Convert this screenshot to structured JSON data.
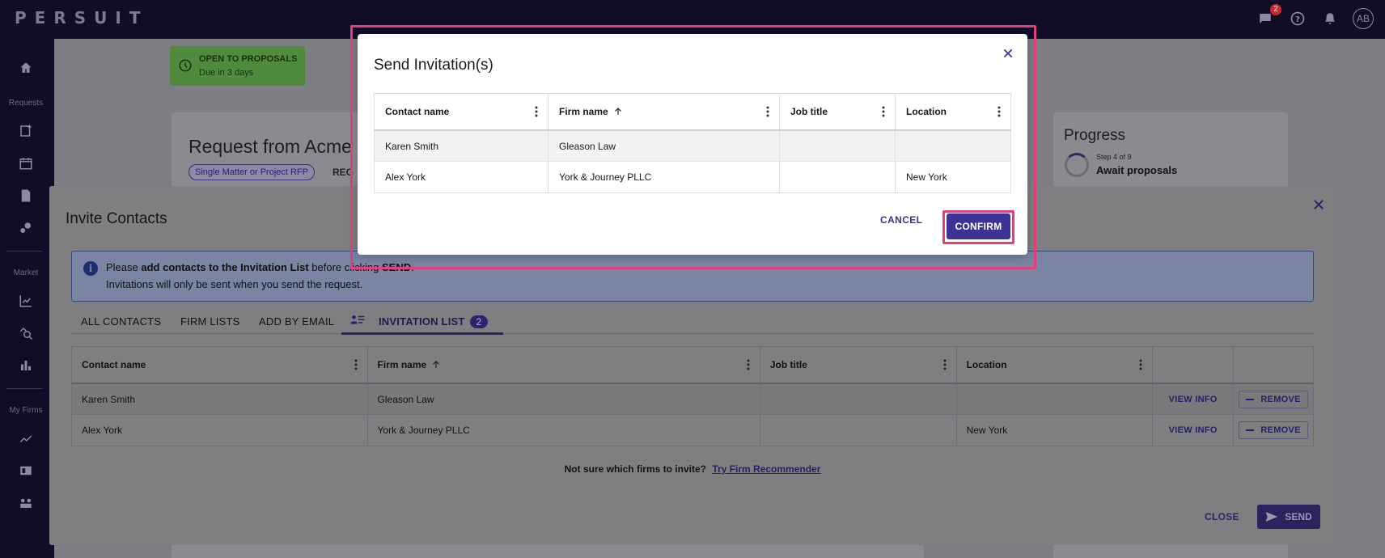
{
  "app": {
    "logo": "PERSUIT",
    "notification_count": "2",
    "avatar_initials": "AB"
  },
  "sidenav": {
    "sections": [
      "Requests",
      "Market",
      "My Firms"
    ]
  },
  "background": {
    "status_title": "OPEN TO PROPOSALS",
    "status_due": "Due in 3 days",
    "request_title": "Request from Acme",
    "request_chip": "Single Matter or Project RFP",
    "request_reg": "REG",
    "progress_title": "Progress",
    "progress_step": "Step 4 of 9",
    "progress_stage": "Await proposals"
  },
  "invite": {
    "title": "Invite Contacts",
    "info_line1_pre": "Please ",
    "info_line1_bold": "add contacts to the Invitation List",
    "info_line1_mid": " before clicking ",
    "info_line1_send": "SEND",
    "info_line1_end": ".",
    "info_line2": "Invitations will only be sent when you send the request.",
    "tabs": [
      "ALL CONTACTS",
      "FIRM LISTS",
      "ADD BY EMAIL",
      "INVITATION LIST"
    ],
    "invitation_count": "2",
    "table": {
      "headers": [
        "Contact name",
        "Firm name",
        "Job title",
        "Location"
      ],
      "rows": [
        {
          "contact": "Karen Smith",
          "firm": "Gleason Law",
          "job": "",
          "location": ""
        },
        {
          "contact": "Alex York",
          "firm": "York & Journey PLLC",
          "job": "",
          "location": "New York"
        }
      ],
      "view_info": "VIEW INFO",
      "remove": "REMOVE"
    },
    "recommend_text": "Not sure which firms to invite?",
    "recommend_link": "Try Firm Recommender",
    "close": "CLOSE",
    "send": "SEND"
  },
  "modal": {
    "title": "Send Invitation(s)",
    "headers": [
      "Contact name",
      "Firm name",
      "Job title",
      "Location"
    ],
    "rows": [
      {
        "contact": "Karen Smith",
        "firm": "Gleason Law",
        "job": "",
        "location": ""
      },
      {
        "contact": "Alex York",
        "firm": "York & Journey PLLC",
        "job": "",
        "location": "New York"
      }
    ],
    "cancel": "CANCEL",
    "confirm": "CONFIRM"
  },
  "colors": {
    "accent": "#3d3296",
    "highlight": "#e0417e",
    "nav_bg": "#0f0e26"
  }
}
